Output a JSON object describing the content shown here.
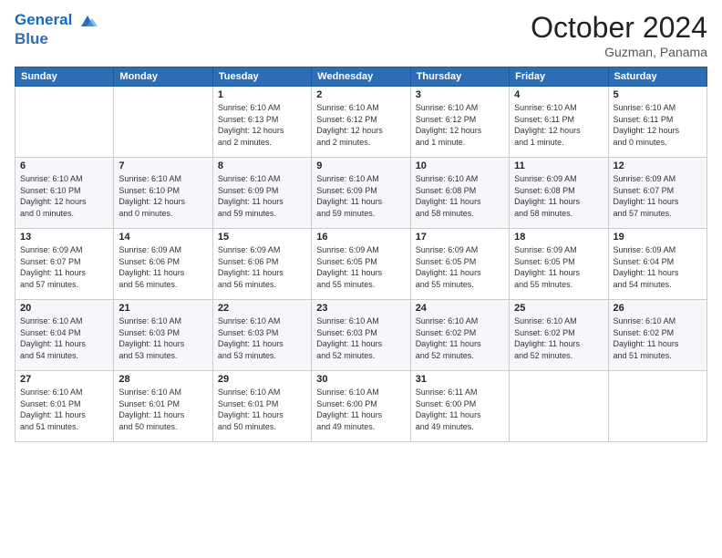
{
  "logo": {
    "line1": "General",
    "line2": "Blue"
  },
  "title": "October 2024",
  "location": "Guzman, Panama",
  "weekdays": [
    "Sunday",
    "Monday",
    "Tuesday",
    "Wednesday",
    "Thursday",
    "Friday",
    "Saturday"
  ],
  "weeks": [
    [
      {
        "day": "",
        "info": ""
      },
      {
        "day": "",
        "info": ""
      },
      {
        "day": "1",
        "info": "Sunrise: 6:10 AM\nSunset: 6:13 PM\nDaylight: 12 hours\nand 2 minutes."
      },
      {
        "day": "2",
        "info": "Sunrise: 6:10 AM\nSunset: 6:12 PM\nDaylight: 12 hours\nand 2 minutes."
      },
      {
        "day": "3",
        "info": "Sunrise: 6:10 AM\nSunset: 6:12 PM\nDaylight: 12 hours\nand 1 minute."
      },
      {
        "day": "4",
        "info": "Sunrise: 6:10 AM\nSunset: 6:11 PM\nDaylight: 12 hours\nand 1 minute."
      },
      {
        "day": "5",
        "info": "Sunrise: 6:10 AM\nSunset: 6:11 PM\nDaylight: 12 hours\nand 0 minutes."
      }
    ],
    [
      {
        "day": "6",
        "info": "Sunrise: 6:10 AM\nSunset: 6:10 PM\nDaylight: 12 hours\nand 0 minutes."
      },
      {
        "day": "7",
        "info": "Sunrise: 6:10 AM\nSunset: 6:10 PM\nDaylight: 12 hours\nand 0 minutes."
      },
      {
        "day": "8",
        "info": "Sunrise: 6:10 AM\nSunset: 6:09 PM\nDaylight: 11 hours\nand 59 minutes."
      },
      {
        "day": "9",
        "info": "Sunrise: 6:10 AM\nSunset: 6:09 PM\nDaylight: 11 hours\nand 59 minutes."
      },
      {
        "day": "10",
        "info": "Sunrise: 6:10 AM\nSunset: 6:08 PM\nDaylight: 11 hours\nand 58 minutes."
      },
      {
        "day": "11",
        "info": "Sunrise: 6:09 AM\nSunset: 6:08 PM\nDaylight: 11 hours\nand 58 minutes."
      },
      {
        "day": "12",
        "info": "Sunrise: 6:09 AM\nSunset: 6:07 PM\nDaylight: 11 hours\nand 57 minutes."
      }
    ],
    [
      {
        "day": "13",
        "info": "Sunrise: 6:09 AM\nSunset: 6:07 PM\nDaylight: 11 hours\nand 57 minutes."
      },
      {
        "day": "14",
        "info": "Sunrise: 6:09 AM\nSunset: 6:06 PM\nDaylight: 11 hours\nand 56 minutes."
      },
      {
        "day": "15",
        "info": "Sunrise: 6:09 AM\nSunset: 6:06 PM\nDaylight: 11 hours\nand 56 minutes."
      },
      {
        "day": "16",
        "info": "Sunrise: 6:09 AM\nSunset: 6:05 PM\nDaylight: 11 hours\nand 55 minutes."
      },
      {
        "day": "17",
        "info": "Sunrise: 6:09 AM\nSunset: 6:05 PM\nDaylight: 11 hours\nand 55 minutes."
      },
      {
        "day": "18",
        "info": "Sunrise: 6:09 AM\nSunset: 6:05 PM\nDaylight: 11 hours\nand 55 minutes."
      },
      {
        "day": "19",
        "info": "Sunrise: 6:09 AM\nSunset: 6:04 PM\nDaylight: 11 hours\nand 54 minutes."
      }
    ],
    [
      {
        "day": "20",
        "info": "Sunrise: 6:10 AM\nSunset: 6:04 PM\nDaylight: 11 hours\nand 54 minutes."
      },
      {
        "day": "21",
        "info": "Sunrise: 6:10 AM\nSunset: 6:03 PM\nDaylight: 11 hours\nand 53 minutes."
      },
      {
        "day": "22",
        "info": "Sunrise: 6:10 AM\nSunset: 6:03 PM\nDaylight: 11 hours\nand 53 minutes."
      },
      {
        "day": "23",
        "info": "Sunrise: 6:10 AM\nSunset: 6:03 PM\nDaylight: 11 hours\nand 52 minutes."
      },
      {
        "day": "24",
        "info": "Sunrise: 6:10 AM\nSunset: 6:02 PM\nDaylight: 11 hours\nand 52 minutes."
      },
      {
        "day": "25",
        "info": "Sunrise: 6:10 AM\nSunset: 6:02 PM\nDaylight: 11 hours\nand 52 minutes."
      },
      {
        "day": "26",
        "info": "Sunrise: 6:10 AM\nSunset: 6:02 PM\nDaylight: 11 hours\nand 51 minutes."
      }
    ],
    [
      {
        "day": "27",
        "info": "Sunrise: 6:10 AM\nSunset: 6:01 PM\nDaylight: 11 hours\nand 51 minutes."
      },
      {
        "day": "28",
        "info": "Sunrise: 6:10 AM\nSunset: 6:01 PM\nDaylight: 11 hours\nand 50 minutes."
      },
      {
        "day": "29",
        "info": "Sunrise: 6:10 AM\nSunset: 6:01 PM\nDaylight: 11 hours\nand 50 minutes."
      },
      {
        "day": "30",
        "info": "Sunrise: 6:10 AM\nSunset: 6:00 PM\nDaylight: 11 hours\nand 49 minutes."
      },
      {
        "day": "31",
        "info": "Sunrise: 6:11 AM\nSunset: 6:00 PM\nDaylight: 11 hours\nand 49 minutes."
      },
      {
        "day": "",
        "info": ""
      },
      {
        "day": "",
        "info": ""
      }
    ]
  ]
}
